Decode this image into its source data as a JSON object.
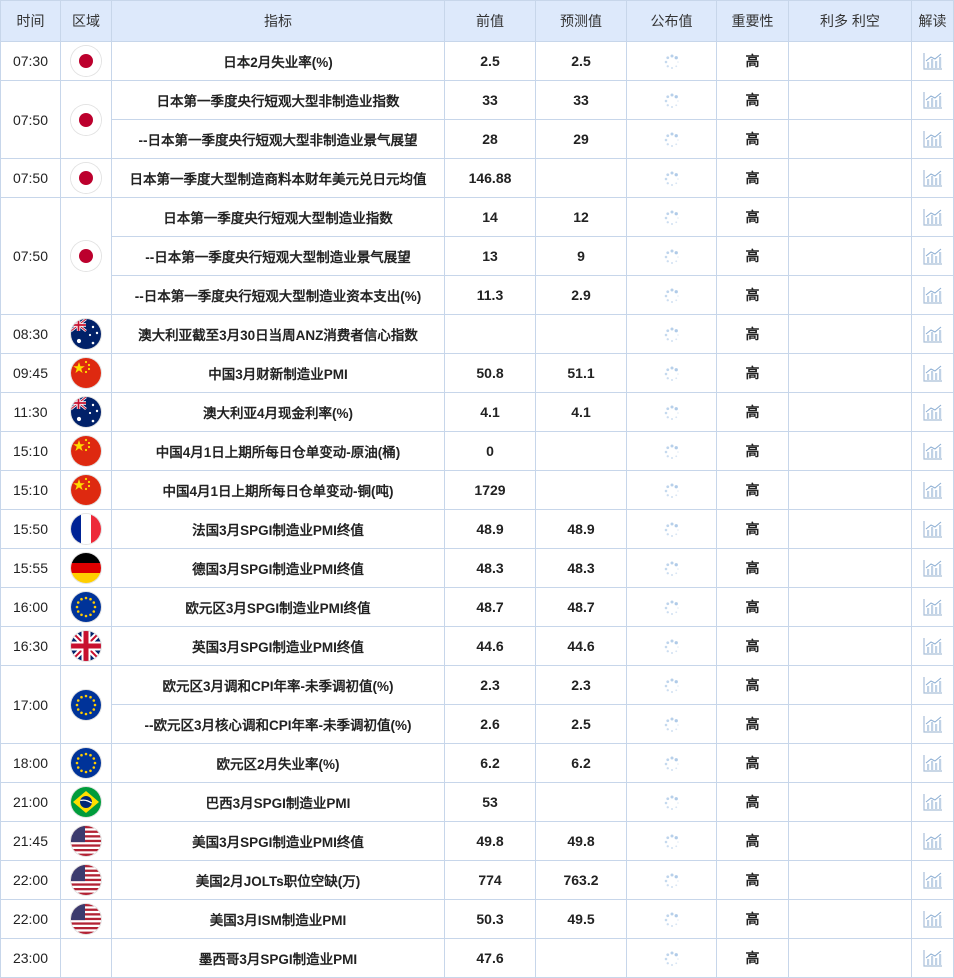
{
  "header": {
    "time": "时间",
    "region": "区域",
    "indicator": "指标",
    "previous": "前值",
    "forecast": "预测值",
    "actual": "公布值",
    "importance": "重要性",
    "impact": "利多 利空",
    "interpret": "解读"
  },
  "icons": {
    "pending": "loading-spinner-icon",
    "interpret": "bar-chart-icon"
  },
  "colors": {
    "header_bg": "#dde9fb",
    "border": "#c7d6ea",
    "accent_red": "#b42318"
  },
  "groups": [
    {
      "time": "07:30",
      "flag": "jp",
      "rows": [
        {
          "name": "日本2月失业率(%)",
          "previous": "2.5",
          "forecast": "2.5",
          "importance": "高"
        }
      ]
    },
    {
      "time": "07:50",
      "flag": "jp",
      "rows": [
        {
          "name": "日本第一季度央行短观大型非制造业指数",
          "previous": "33",
          "forecast": "33",
          "importance": "高"
        },
        {
          "name": "--日本第一季度央行短观大型非制造业景气展望",
          "previous": "28",
          "forecast": "29",
          "importance": "高"
        }
      ]
    },
    {
      "time": "07:50",
      "flag": "jp",
      "rows": [
        {
          "name": "日本第一季度大型制造商料本财年美元兑日元均值",
          "previous": "146.88",
          "forecast": "",
          "importance": "高"
        }
      ]
    },
    {
      "time": "07:50",
      "flag": "jp",
      "rows": [
        {
          "name": "日本第一季度央行短观大型制造业指数",
          "previous": "14",
          "forecast": "12",
          "importance": "高"
        },
        {
          "name": "--日本第一季度央行短观大型制造业景气展望",
          "previous": "13",
          "forecast": "9",
          "importance": "高"
        },
        {
          "name": "--日本第一季度央行短观大型制造业资本支出(%)",
          "previous": "11.3",
          "forecast": "2.9",
          "importance": "高"
        }
      ]
    },
    {
      "time": "08:30",
      "flag": "au",
      "rows": [
        {
          "name": "澳大利亚截至3月30日当周ANZ消费者信心指数",
          "previous": "",
          "forecast": "",
          "importance": "高"
        }
      ]
    },
    {
      "time": "09:45",
      "flag": "cn",
      "rows": [
        {
          "name": "中国3月财新制造业PMI",
          "previous": "50.8",
          "forecast": "51.1",
          "importance": "高"
        }
      ]
    },
    {
      "time": "11:30",
      "flag": "au",
      "rows": [
        {
          "name": "澳大利亚4月现金利率(%)",
          "previous": "4.1",
          "forecast": "4.1",
          "importance": "高"
        }
      ]
    },
    {
      "time": "15:10",
      "flag": "cn",
      "rows": [
        {
          "name": "中国4月1日上期所每日仓单变动-原油(桶)",
          "previous": "0",
          "forecast": "",
          "importance": "高"
        }
      ]
    },
    {
      "time": "15:10",
      "flag": "cn",
      "rows": [
        {
          "name": "中国4月1日上期所每日仓单变动-铜(吨)",
          "previous": "1729",
          "forecast": "",
          "importance": "高"
        }
      ]
    },
    {
      "time": "15:50",
      "flag": "fr",
      "rows": [
        {
          "name": "法国3月SPGI制造业PMI终值",
          "previous": "48.9",
          "forecast": "48.9",
          "importance": "高"
        }
      ]
    },
    {
      "time": "15:55",
      "flag": "de",
      "rows": [
        {
          "name": "德国3月SPGI制造业PMI终值",
          "previous": "48.3",
          "forecast": "48.3",
          "importance": "高"
        }
      ]
    },
    {
      "time": "16:00",
      "flag": "eu",
      "rows": [
        {
          "name": "欧元区3月SPGI制造业PMI终值",
          "previous": "48.7",
          "forecast": "48.7",
          "importance": "高"
        }
      ]
    },
    {
      "time": "16:30",
      "flag": "gb",
      "rows": [
        {
          "name": "英国3月SPGI制造业PMI终值",
          "previous": "44.6",
          "forecast": "44.6",
          "importance": "高"
        }
      ]
    },
    {
      "time": "17:00",
      "flag": "eu",
      "rows": [
        {
          "name": "欧元区3月调和CPI年率-未季调初值(%)",
          "previous": "2.3",
          "forecast": "2.3",
          "importance": "高"
        },
        {
          "name": "--欧元区3月核心调和CPI年率-未季调初值(%)",
          "previous": "2.6",
          "forecast": "2.5",
          "importance": "高"
        }
      ]
    },
    {
      "time": "18:00",
      "flag": "eu",
      "rows": [
        {
          "name": "欧元区2月失业率(%)",
          "previous": "6.2",
          "forecast": "6.2",
          "importance": "高"
        }
      ]
    },
    {
      "time": "21:00",
      "flag": "br",
      "rows": [
        {
          "name": "巴西3月SPGI制造业PMI",
          "previous": "53",
          "forecast": "",
          "importance": "高"
        }
      ]
    },
    {
      "time": "21:45",
      "flag": "us",
      "rows": [
        {
          "name": "美国3月SPGI制造业PMI终值",
          "previous": "49.8",
          "forecast": "49.8",
          "importance": "高"
        }
      ]
    },
    {
      "time": "22:00",
      "flag": "us",
      "rows": [
        {
          "name": "美国2月JOLTs职位空缺(万)",
          "previous": "774",
          "forecast": "763.2",
          "importance": "高"
        }
      ]
    },
    {
      "time": "22:00",
      "flag": "us",
      "rows": [
        {
          "name": "美国3月ISM制造业PMI",
          "previous": "50.3",
          "forecast": "49.5",
          "importance": "高"
        }
      ]
    },
    {
      "time": "23:00",
      "flag": "",
      "rows": [
        {
          "name": "墨西哥3月SPGI制造业PMI",
          "previous": "47.6",
          "forecast": "",
          "importance": "高"
        }
      ]
    }
  ]
}
